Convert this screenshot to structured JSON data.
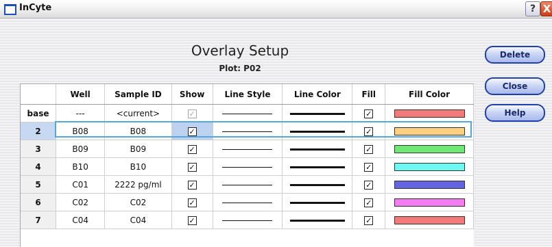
{
  "window": {
    "title": "InCyte"
  },
  "titlebar": {
    "help_glyph": "?",
    "close_glyph": "X"
  },
  "header": {
    "title": "Overlay Setup",
    "plot_label": "Plot: P02"
  },
  "buttons": {
    "delete": "Delete",
    "close": "Close",
    "help": "Help"
  },
  "grid": {
    "columns": [
      "",
      "Well",
      "Sample ID",
      "Show",
      "Line Style",
      "Line Color",
      "Fill",
      "Fill Color"
    ],
    "rows": [
      {
        "id": "base",
        "well": "---",
        "sample_id": "<current>",
        "show": true,
        "show_enabled": false,
        "fill": true,
        "fill_color": "#f47a7a"
      },
      {
        "id": "2",
        "well": "B08",
        "sample_id": "B08",
        "show": true,
        "show_enabled": true,
        "fill": true,
        "fill_color": "#ffd080"
      },
      {
        "id": "3",
        "well": "B09",
        "sample_id": "B09",
        "show": true,
        "show_enabled": true,
        "fill": true,
        "fill_color": "#6ee874"
      },
      {
        "id": "4",
        "well": "B10",
        "sample_id": "B10",
        "show": true,
        "show_enabled": true,
        "fill": true,
        "fill_color": "#6ef8f4"
      },
      {
        "id": "5",
        "well": "C01",
        "sample_id": "2222 pg/ml",
        "show": true,
        "show_enabled": true,
        "fill": true,
        "fill_color": "#6464e0"
      },
      {
        "id": "6",
        "well": "C02",
        "sample_id": "C02",
        "show": true,
        "show_enabled": true,
        "fill": true,
        "fill_color": "#f47cf0"
      },
      {
        "id": "7",
        "well": "C04",
        "sample_id": "C04",
        "show": true,
        "show_enabled": true,
        "fill": true,
        "fill_color": "#f47a7a"
      }
    ],
    "selected_row": "2"
  },
  "icons": {
    "app": "app-window-icon",
    "check": "checkmark-icon"
  }
}
